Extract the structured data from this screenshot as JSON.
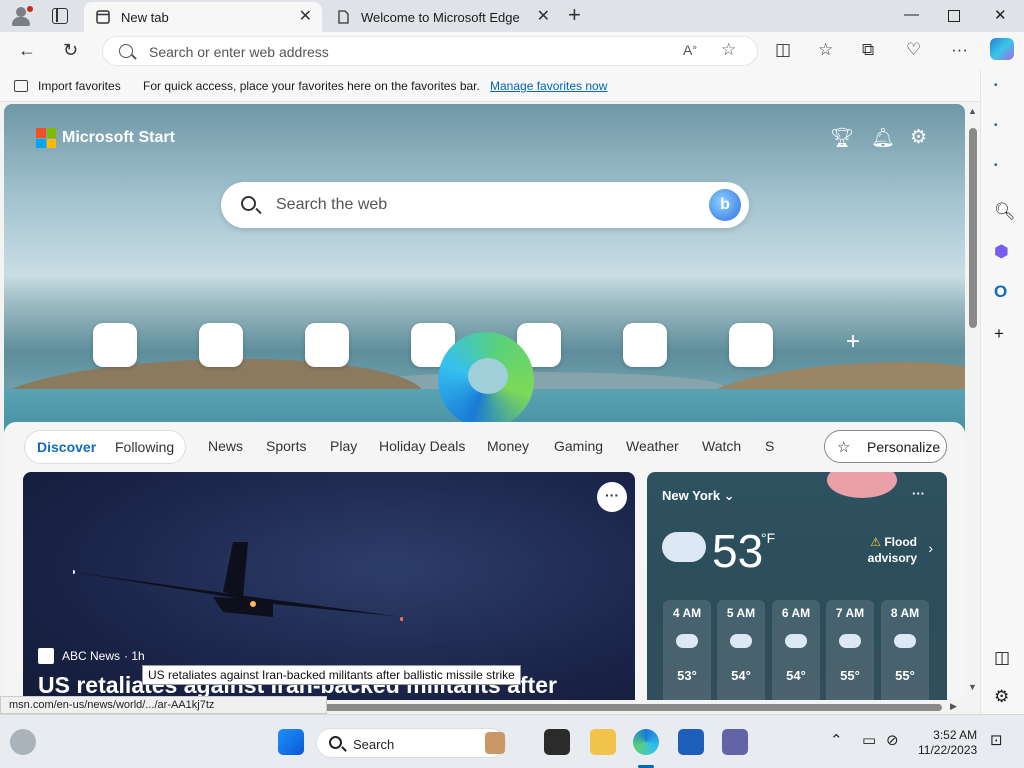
{
  "browser": {
    "tabs": [
      {
        "label": "New tab",
        "active": true
      },
      {
        "label": "Welcome to Microsoft Edge",
        "active": false
      }
    ],
    "address_placeholder": "Search or enter web address",
    "favorites_bar": {
      "import_label": "Import favorites",
      "message": "For quick access, place your favorites here on the favorites bar.",
      "manage_link": "Manage favorites now"
    },
    "status_url": "msn.com/en-us/news/world/.../ar-AA1kj7tz"
  },
  "newtab": {
    "brand": "Microsoft Start",
    "search_placeholder": "Search the web",
    "feed_tabs": {
      "discover": "Discover",
      "following": "Following",
      "categories": [
        "News",
        "Sports",
        "Play",
        "Holiday Deals",
        "Money",
        "Gaming",
        "Weather",
        "Watch",
        "S"
      ]
    },
    "personalize_label": "Personalize",
    "news": {
      "source": "ABC News",
      "source_suffix": "· 1h",
      "headline": "US retaliates against Iran-backed militants after",
      "tooltip": "US retaliates against Iran-backed militants after ballistic missile strike"
    },
    "weather": {
      "city": "New York",
      "temp": "53",
      "unit": "°F",
      "advisory_line1": "Flood",
      "advisory_line2": "advisory",
      "hourly": [
        {
          "time": "4 AM",
          "temp": "53°"
        },
        {
          "time": "5 AM",
          "temp": "54°"
        },
        {
          "time": "6 AM",
          "temp": "54°"
        },
        {
          "time": "7 AM",
          "temp": "55°"
        },
        {
          "time": "8 AM",
          "temp": "55°"
        }
      ]
    }
  },
  "taskbar": {
    "search_label": "Search",
    "time": "3:52 AM",
    "date": "11/22/2023"
  },
  "colors": {
    "accent": "#0f6cbd",
    "link": "#0067b8"
  }
}
